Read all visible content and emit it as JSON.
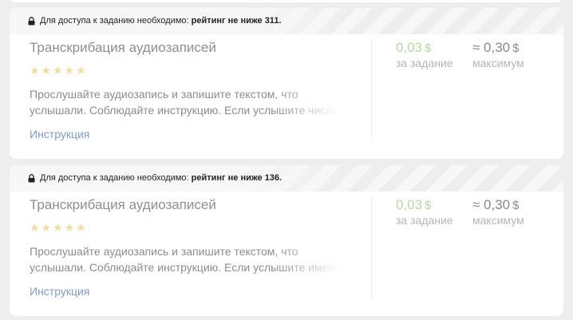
{
  "tasks": [
    {
      "notice_prefix": "Для доступа к заданию необходимо:",
      "notice_requirement": "рейтинг не ниже 311.",
      "title": "Транскрибация аудиозаписей",
      "rating_stars": "★★★★★",
      "rating_value": 0,
      "description_line1": "Прослушайте аудиозапись и запишите текстом, что",
      "description_line2": "услышали. Соблюдайте инструкцию. Если услышите числа",
      "instruction_link": "Инструкция",
      "price": "0,03",
      "price_currency": "$",
      "price_label": "за задание",
      "max_price": "≈ 0,30",
      "max_currency": "$",
      "max_label": "максимум"
    },
    {
      "notice_prefix": "Для доступа к заданию необходимо:",
      "notice_requirement": "рейтинг не ниже 136.",
      "title": "Транскрибация аудиозаписей",
      "rating_stars": "★★★★★",
      "rating_value": 0,
      "description_line1": "Прослушайте аудиозапись и запишите текстом, что",
      "description_line2": "услышали. Соблюдайте инструкцию. Если услышите имена",
      "instruction_link": "Инструкция",
      "price": "0,03",
      "price_currency": "$",
      "price_label": "за задание",
      "max_price": "≈ 0,30",
      "max_currency": "$",
      "max_label": "максимум"
    }
  ],
  "colors": {
    "page_background": "#eceeef",
    "price_green": "#b8d7a3",
    "link_blue": "#7d9dc6",
    "star_yellow": "#f2de9a"
  }
}
